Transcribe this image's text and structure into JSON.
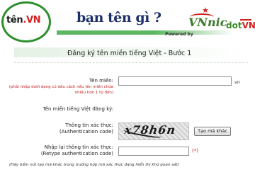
{
  "header": {
    "logo_ten": "tên",
    "logo_vn": ".VN",
    "slogan": "bạn tên gì ?",
    "powered_by": "Powered by",
    "vnnic": "VNnic",
    "dotvn_dot": "dot",
    "dotvn_vn": "VN"
  },
  "title": "Đăng ký tên miền tiếng Việt - Bước 1",
  "form": {
    "domain_label": "Tên miền:",
    "domain_hint": "(phải nhập dưới dạng có dấu cách nếu tên miền chứa nhiều hơn 1 từ đơn)",
    "domain_value": "",
    "domain_suffix": ".vn",
    "registered_label": "Tên miền tiếng Việt đăng ký:",
    "auth_label": "Thông tin xác thực:",
    "auth_label_en": "(Authentication code)",
    "captcha_text": "x78h6n",
    "new_code_button": "Tạo mã khác",
    "retype_label": "Nhập lại thông tin xác thực:",
    "retype_label_en": "(Retype authentication code)",
    "retype_value": "",
    "required_mark": "(*)",
    "note": "(Hãy bấm nút tạo mã khác trong trường hợp mã xác thực đang hiển thị khó quan sát)"
  },
  "colors": {
    "brand_green": "#2e8f2e",
    "brand_red": "#d32020",
    "slogan_navy": "#1d2f6b",
    "hint_red": "#c21b1b"
  }
}
